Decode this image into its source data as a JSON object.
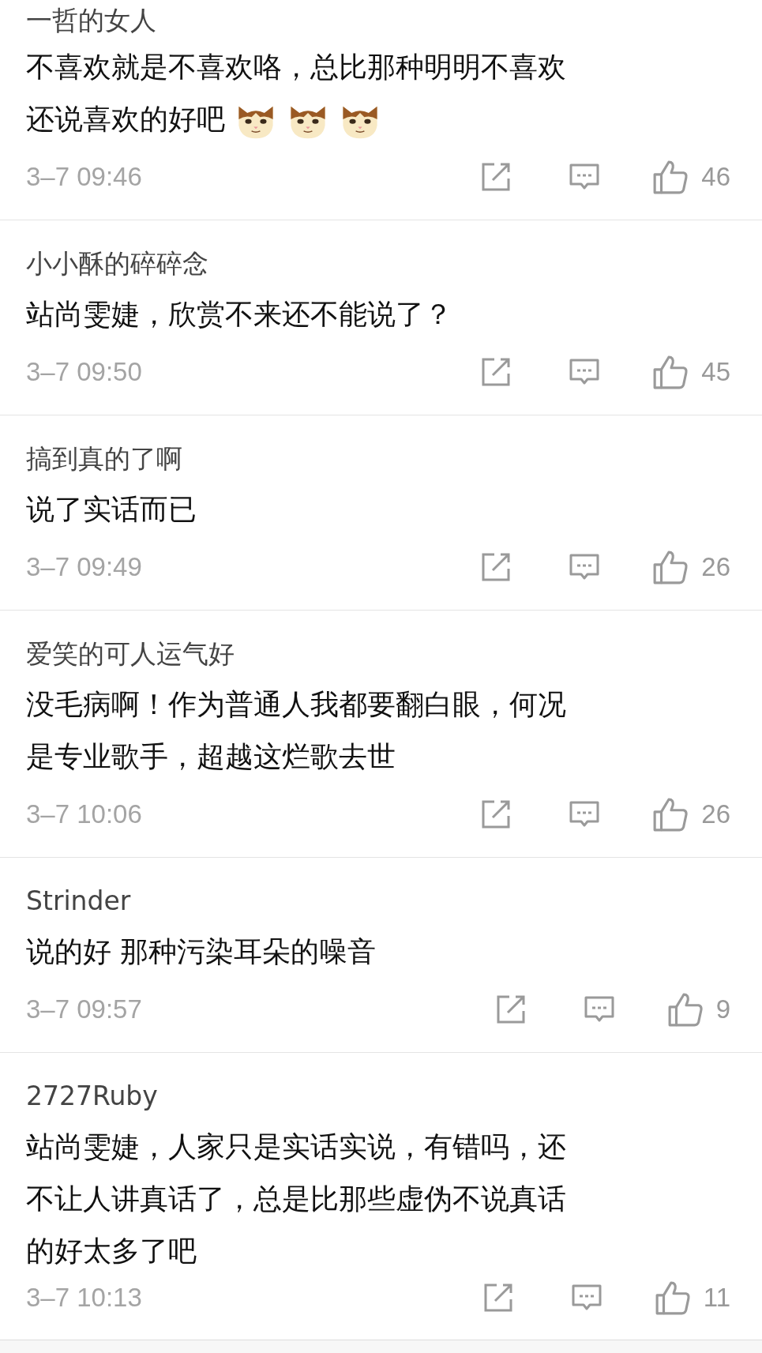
{
  "comments": [
    {
      "author": "一哲的女人",
      "lines": [
        "不喜欢就是不喜欢咯，总比那种明明不喜欢",
        "还说喜欢的好吧"
      ],
      "emojis": [
        {
          "kind": "cat"
        },
        {
          "kind": "cat"
        },
        {
          "kind": "cat"
        }
      ],
      "time": "3–7 09:46",
      "likes": "46"
    },
    {
      "author": "小小酥的碎碎念",
      "lines": [
        "站尚雯婕，欣赏不来还不能说了？"
      ],
      "time": "3–7 09:50",
      "likes": "45"
    },
    {
      "author": "搞到真的了啊",
      "lines": [
        "说了实话而已"
      ],
      "time": "3–7 09:49",
      "likes": "26"
    },
    {
      "author": "爱笑的可人运气好",
      "lines": [
        "没毛病啊！作为普通人我都要翻白眼，何况",
        "是专业歌手，超越这烂歌去世"
      ],
      "time": "3–7 10:06",
      "likes": "26"
    },
    {
      "author": "Strinder",
      "lines": [
        "说的好 那种污染耳朵的噪音"
      ],
      "time": "3–7 09:57",
      "likes": "9"
    },
    {
      "author": "2727Ruby",
      "lines": [
        "站尚雯婕，人家只是实话实说，有错吗，还",
        "不让人讲真话了，总是比那些虚伪不说真话",
        "的好太多了吧"
      ],
      "time": "3–7 10:13",
      "likes": "11"
    }
  ]
}
